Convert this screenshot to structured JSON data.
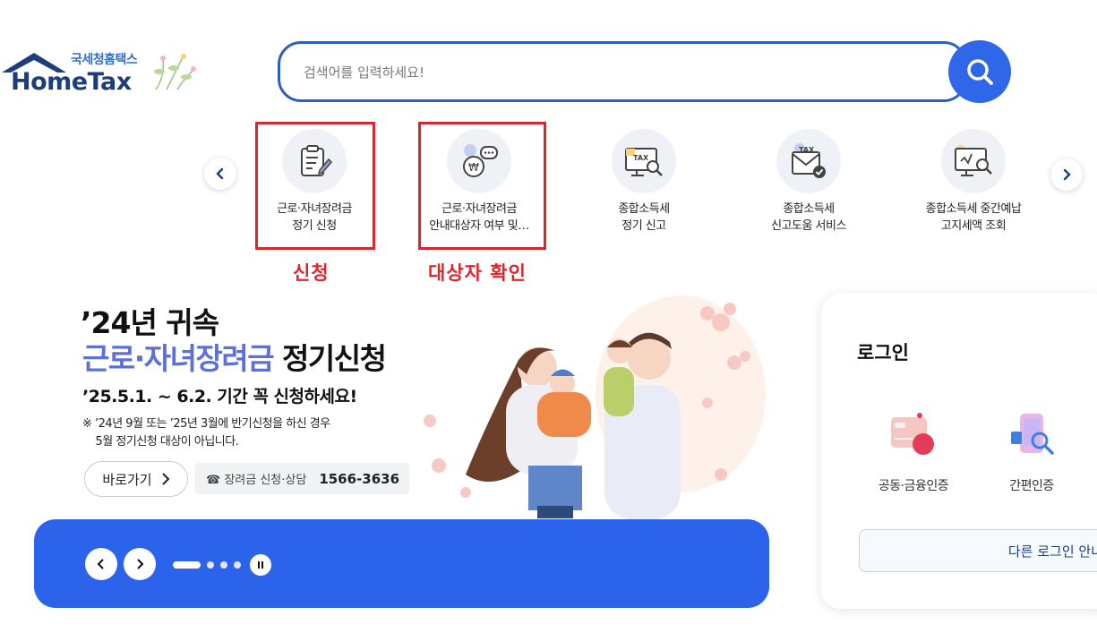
{
  "header": {
    "logo_kr": "국세청홈택스",
    "logo_en": "HomeTax"
  },
  "search": {
    "placeholder": "검색어를 입력하세요!",
    "value": ""
  },
  "quick_menu": {
    "items": [
      {
        "label": "근로·자녀장려금\n정기 신청",
        "icon": "clipboard-pen-icon"
      },
      {
        "label": "근로·자녀장려금\n안내대상자 여부 및…",
        "icon": "money-chat-icon"
      },
      {
        "label": "종합소득세\n정기 신고",
        "icon": "tax-monitor-icon"
      },
      {
        "label": "종합소득세\n신고도움 서비스",
        "icon": "tax-envelope-icon"
      },
      {
        "label": "종합소득세 중간예납\n고지세액 조회",
        "icon": "won-monitor-search-icon"
      }
    ],
    "annotations": {
      "apply": "신청",
      "check_target": "대상자 확인"
    }
  },
  "banner": {
    "line1": "’24년 귀속",
    "line2_accent": "근로·자녀장려금",
    "line2_rest": " 정기신청",
    "period": "’25.5.1. ~ 6.2. 기간 꼭 신청하세요!",
    "note": "※ ’24년 9월 또는 ’25년 3월에 반기신청을 하신 경우\n    5월 정기신청 대상이 아닙니다.",
    "go_label": "바로가기",
    "phone_label": "☎ 장려금 신청·상담",
    "phone_number": "1566-3636",
    "slide_count": 4,
    "active_slide": 1
  },
  "login": {
    "title": "로그인",
    "cert_label": "공동·금융인증",
    "simple_label": "간편인증",
    "other_label": "다른 로그인 안내"
  },
  "colors": {
    "primary_blue": "#2b64ea",
    "navy": "#1d3e7c",
    "annotation_red": "#e0252c",
    "accent_purple": "#5d6fd8"
  }
}
